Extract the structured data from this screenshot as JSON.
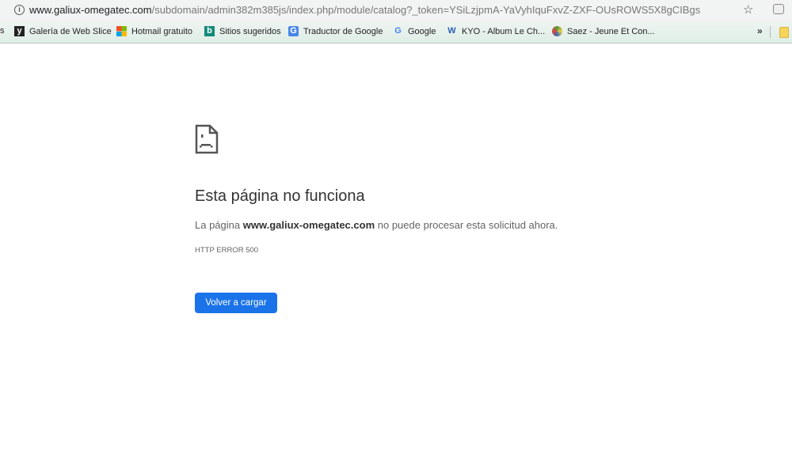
{
  "browser": {
    "url_host": "www.galiux-omegatec.com",
    "url_path": "/subdomain/admin382m385js/index.php/module/catalog?_token=YSiLzjpmA-YaVyhIquFxvZ-ZXF-OUsROWS5X8gCIBgs",
    "bookmarks": [
      {
        "label": "s"
      },
      {
        "label": "Galería de Web Slice",
        "icon": "web-slice-icon"
      },
      {
        "label": "Hotmail gratuito",
        "icon": "windows-icon"
      },
      {
        "label": "Sitios sugeridos",
        "icon": "bing-icon"
      },
      {
        "label": "Traductor de Google",
        "icon": "translate-icon"
      },
      {
        "label": "Google",
        "icon": "google-icon"
      },
      {
        "label": "KYO - Album Le Ch...",
        "icon": "w-icon"
      },
      {
        "label": "Saez - Jeune Et Con...",
        "icon": "globe-icon"
      }
    ],
    "more_label": "»"
  },
  "error": {
    "title": "Esta página no funciona",
    "desc_prefix": "La página ",
    "desc_host": "www.galiux-omegatec.com",
    "desc_suffix": " no puede procesar esta solicitud ahora.",
    "code": "HTTP ERROR 500",
    "reload_label": "Volver a cargar",
    "accent": "#1a73e8"
  }
}
